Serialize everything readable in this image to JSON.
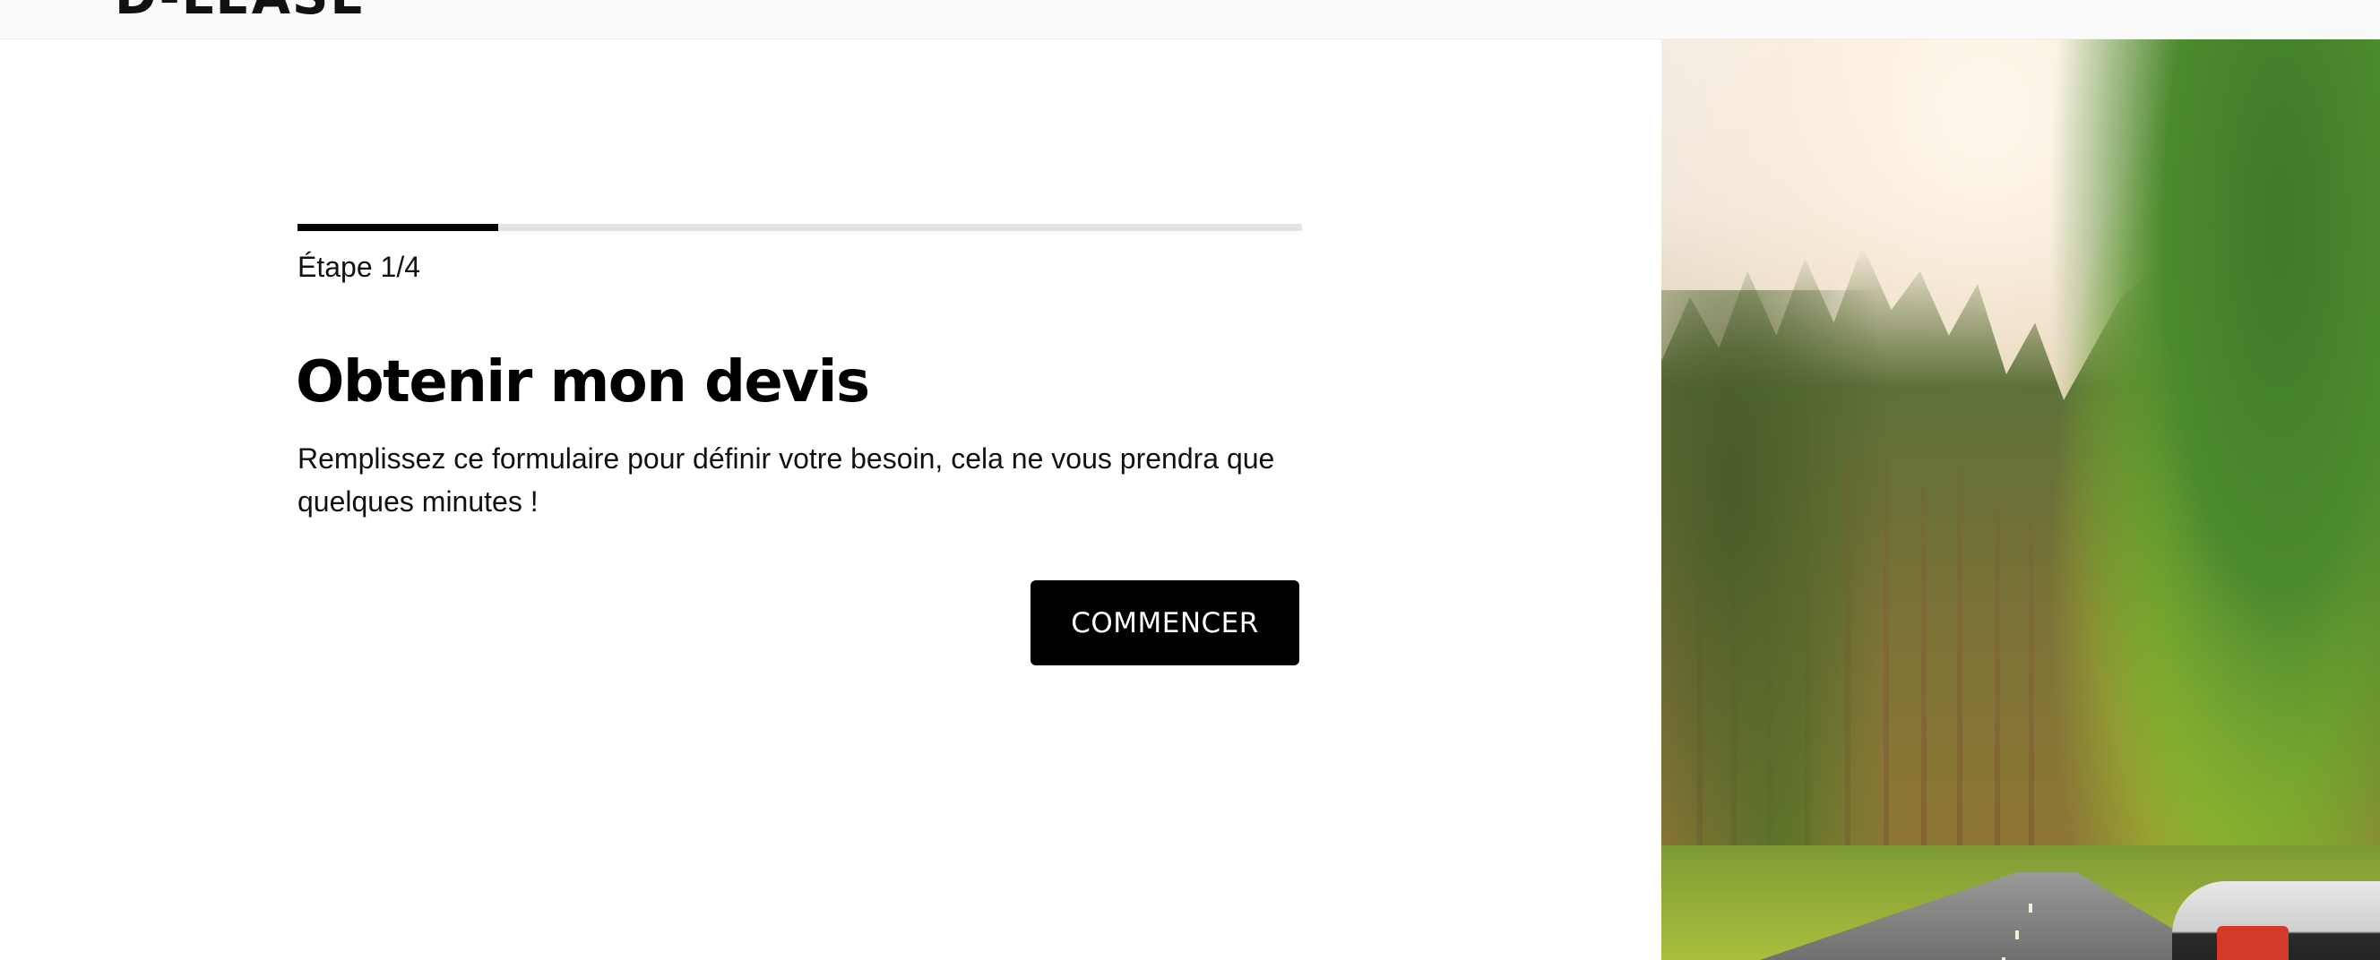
{
  "header": {
    "logo_text": "D-LEASE"
  },
  "form": {
    "progress": {
      "current_step": 1,
      "total_steps": 4,
      "fraction_complete": 0.2,
      "step_label": "Étape 1/4"
    },
    "title": "Obtenir mon devis",
    "description": "Remplissez ce formulaire pour définir votre besoin, cela ne vous prendra que quelques minutes !",
    "start_button_label": "COMMENCER"
  },
  "hero_image": {
    "subject": "car driving on a forest road"
  },
  "colors": {
    "accent": "#000000",
    "header_bg": "#fafafa",
    "progress_track": "#e3e3e3",
    "button_text": "#ffffff"
  }
}
